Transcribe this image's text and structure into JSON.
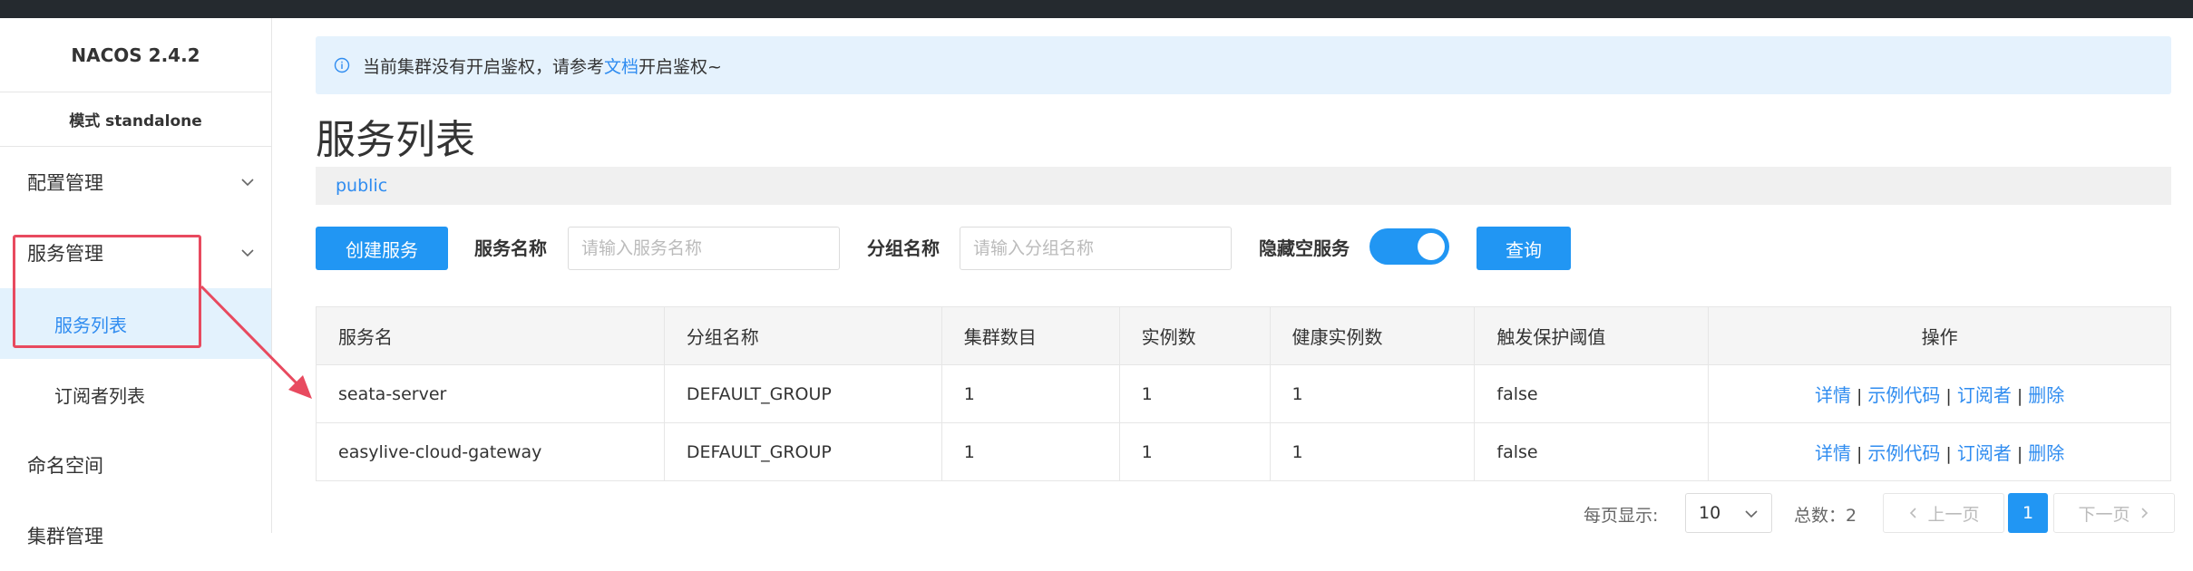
{
  "app": {
    "brand": "NACOS 2.4.2",
    "mode": "模式 standalone"
  },
  "sidebar": {
    "items": [
      {
        "label": "配置管理"
      },
      {
        "label": "服务管理"
      },
      {
        "label": "服务列表"
      },
      {
        "label": "订阅者列表"
      },
      {
        "label": "命名空间"
      },
      {
        "label": "集群管理"
      }
    ]
  },
  "notice": {
    "prefix": "当前集群没有开启鉴权，请参考",
    "link": "文档",
    "suffix": "开启鉴权~"
  },
  "page": {
    "title": "服务列表",
    "namespace": "public"
  },
  "filters": {
    "create_label": "创建服务",
    "service_name_label": "服务名称",
    "service_name_placeholder": "请输入服务名称",
    "group_name_label": "分组名称",
    "group_name_placeholder": "请输入分组名称",
    "hide_empty_label": "隐藏空服务",
    "hide_empty_on": true,
    "query_label": "查询"
  },
  "table": {
    "headers": [
      "服务名",
      "分组名称",
      "集群数目",
      "实例数",
      "健康实例数",
      "触发保护阈值",
      "操作"
    ],
    "rows": [
      [
        "seata-server",
        "DEFAULT_GROUP",
        "1",
        "1",
        "1",
        "false"
      ],
      [
        "easylive-cloud-gateway",
        "DEFAULT_GROUP",
        "1",
        "1",
        "1",
        "false"
      ]
    ],
    "actions": [
      "详情",
      "示例代码",
      "订阅者",
      "删除"
    ],
    "action_sep": "|"
  },
  "pagination": {
    "per_page_label": "每页显示:",
    "per_page": "10",
    "total_label": "总数：2",
    "prev": "上一页",
    "current": "1",
    "next": "下一页"
  },
  "colors": {
    "accent": "#2196f3",
    "link": "#2f8cf0",
    "highlight": "#e84a5f",
    "topbar": "#252a2f"
  }
}
